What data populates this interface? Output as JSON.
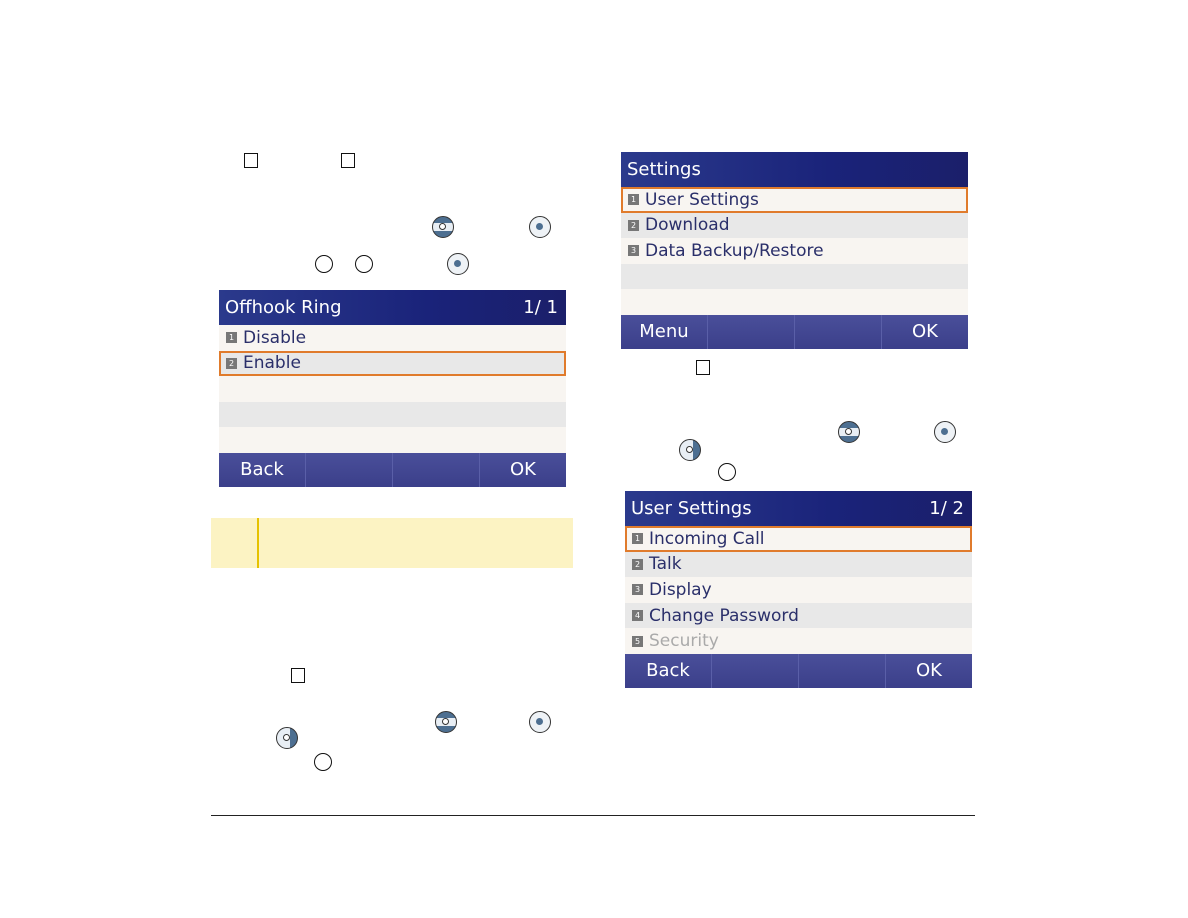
{
  "offhook_screen": {
    "title": "Offhook Ring",
    "page": "1/ 1",
    "items": [
      {
        "num": "1",
        "label": "Disable"
      },
      {
        "num": "2",
        "label": "Enable",
        "selected": true
      }
    ],
    "softkeys": [
      "Back",
      "",
      "",
      "OK"
    ]
  },
  "settings_screen": {
    "title": "Settings",
    "page": "",
    "items": [
      {
        "num": "1",
        "label": "User Settings",
        "selected": true
      },
      {
        "num": "2",
        "label": "Download"
      },
      {
        "num": "3",
        "label": "Data Backup/Restore"
      }
    ],
    "softkeys": [
      "Menu",
      "",
      "",
      "OK"
    ]
  },
  "user_settings_screen": {
    "title": "User Settings",
    "page": "1/ 2",
    "items": [
      {
        "num": "1",
        "label": "Incoming Call",
        "selected": true
      },
      {
        "num": "2",
        "label": "Talk"
      },
      {
        "num": "3",
        "label": "Display"
      },
      {
        "num": "4",
        "label": "Change Password"
      },
      {
        "num": "5",
        "label": "Security",
        "disabled": true
      }
    ],
    "softkeys": [
      "Back",
      "",
      "",
      "OK"
    ]
  },
  "colors": {
    "note_bg": "#fcf3c3",
    "note_bar": "#e6c200",
    "selection": "#e07b2c",
    "title_bar": "#1a237a"
  }
}
